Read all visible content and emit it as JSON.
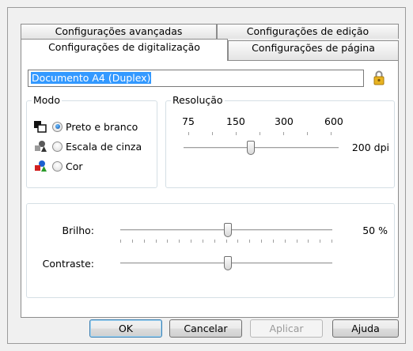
{
  "tabs": {
    "back": [
      "Configurações avançadas",
      "Configurações de edição"
    ],
    "front": [
      "Configurações de digitalização",
      "Configurações de página"
    ]
  },
  "profile_name": "Documento A4 (Duplex)",
  "mode": {
    "legend": "Modo",
    "options": [
      "Preto e branco",
      "Escala de cinza",
      "Cor"
    ],
    "selected": "Preto e branco"
  },
  "resolution": {
    "legend": "Resolução",
    "ticks": [
      "75",
      "150",
      "300",
      "600"
    ],
    "value_text": "200 dpi",
    "value_dpi": 200
  },
  "brightness": {
    "label": "Brilho:",
    "value_text": "50 %",
    "value_percent": 50
  },
  "contrast": {
    "label": "Contraste:",
    "value_percent": 50
  },
  "buttons": {
    "ok": "OK",
    "cancel": "Cancelar",
    "apply": "Aplicar",
    "help": "Ajuda"
  },
  "colors": {
    "selection": "#3399ff",
    "group_border": "#d5dfe5"
  },
  "icons": [
    "lock-icon",
    "black-white-mode-icon",
    "grayscale-mode-icon",
    "color-mode-icon"
  ]
}
